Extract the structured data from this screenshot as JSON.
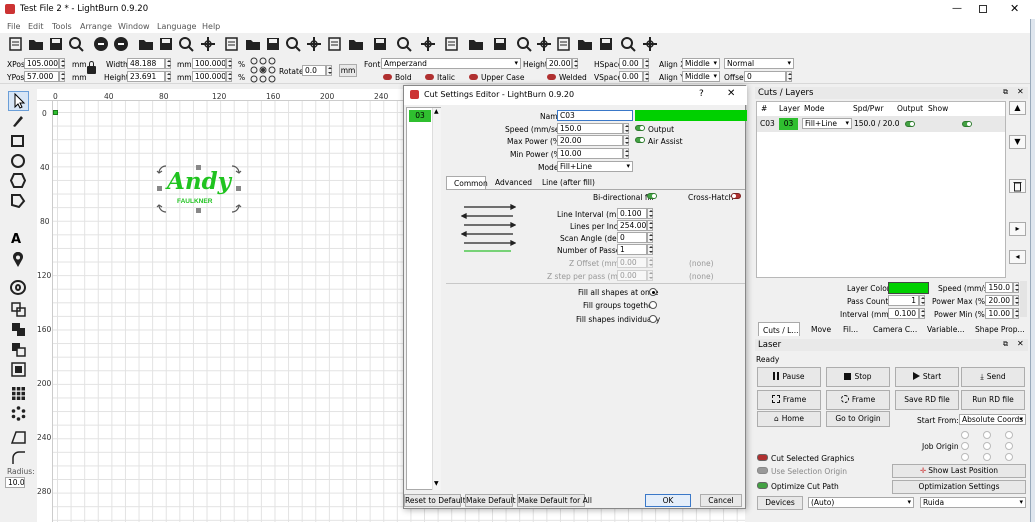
{
  "window": {
    "title": "Test File 2 * - LightBurn 0.9.20"
  },
  "menu": [
    "File",
    "Edit",
    "Tools",
    "Arrange",
    "Window",
    "Language",
    "Help"
  ],
  "props": {
    "xpos_label": "XPos",
    "xpos": "105.000",
    "ypos_label": "YPos",
    "ypos": "57.000",
    "unit": "mm",
    "width_label": "Width",
    "width": "48.188",
    "height_label": "Height",
    "height": "23.691",
    "wpct": "100.000",
    "hpct": "100.000",
    "pct": "%",
    "rotate_label": "Rotate",
    "rotate": "0.0",
    "mm_btn": "mm",
    "font_label": "Font",
    "font": "Amperzand",
    "fheight_label": "Height",
    "fheight": "20.00",
    "hspace_label": "HSpace",
    "hspace": "0.00",
    "vspace_label": "VSpace",
    "vspace": "0.00",
    "alignx_label": "Align X",
    "alignx": "Middle",
    "aligny_label": "Align Y",
    "aligny": "Middle",
    "style": "Normal",
    "offset_label": "Offset",
    "offset": "0",
    "bold": "Bold",
    "italic": "Italic",
    "upper": "Upper Case",
    "welded": "Welded"
  },
  "rulers": {
    "top": [
      "0",
      "40",
      "80",
      "120",
      "160",
      "200",
      "240"
    ],
    "left": [
      "0",
      "40",
      "80",
      "120",
      "160",
      "200",
      "240",
      "280"
    ]
  },
  "canvas_text": {
    "name": "Andy",
    "sub": "FAULKNER"
  },
  "left_toolbar": {
    "radius_label": "Radius:",
    "radius": "10.0"
  },
  "dialog": {
    "title": "Cut Settings Editor - LightBurn 0.9.20",
    "help": "?",
    "close": "✕",
    "layer_num": "03",
    "name_label": "Name",
    "name": "C03",
    "speed_label": "Speed (mm/sec)",
    "speed": "150.0",
    "maxp_label": "Max Power (%)",
    "maxp": "20.00",
    "minp_label": "Min Power (%)",
    "minp": "10.00",
    "mode_label": "Mode",
    "mode": "Fill+Line",
    "output": "Output",
    "air": "Air Assist",
    "tabs": [
      "Common",
      "Advanced",
      "Line (after fill)"
    ],
    "bidir": "Bi-directional fill",
    "cross": "Cross-Hatch",
    "interval_label": "Line Interval (mm)",
    "interval": "0.100",
    "lpi_label": "Lines per Inch",
    "lpi": "254.00",
    "angle_label": "Scan Angle (deg)",
    "angle": "0",
    "passes_label": "Number of Passes",
    "passes": "1",
    "zoff_label": "Z Offset (mm)",
    "zoff": "0.00",
    "zoff_none": "(none)",
    "zstep_label": "Z step per pass (mm)",
    "zstep": "0.00",
    "zstep_none": "(none)",
    "fill_all": "Fill all shapes at once",
    "fill_groups": "Fill groups together",
    "fill_ind": "Fill shapes individually",
    "reset": "Reset to Default",
    "make_default": "Make Default",
    "make_all": "Make Default for All",
    "ok": "OK",
    "cancel": "Cancel"
  },
  "cuts": {
    "title": "Cuts / Layers",
    "headers": [
      "#",
      "Layer",
      "Mode",
      "Spd/Pwr",
      "Output",
      "Show"
    ],
    "row": {
      "num": "C03",
      "layer": "03",
      "mode": "Fill+Line",
      "spdpwr": "150.0 / 20.0"
    },
    "layer_color": "Layer Color",
    "speed_label": "Speed (mm/s)",
    "speed": "150.0",
    "pass_label": "Pass Count",
    "pass": "1",
    "pmax_label": "Power Max (%)",
    "pmax": "20.00",
    "int_label": "Interval (mm)",
    "int": "0.100",
    "pmin_label": "Power Min (%)",
    "pmin": "10.00",
    "tabs": [
      "Cuts / L...",
      "Move",
      "Fil...",
      "Camera C...",
      "Variable...",
      "Shape Prop..."
    ]
  },
  "laser": {
    "title": "Laser",
    "status": "Ready",
    "pause": "Pause",
    "stop": "Stop",
    "start": "Start",
    "send": "Send",
    "frame1": "Frame",
    "frame2": "Frame",
    "save_rd": "Save RD file",
    "run_rd": "Run RD file",
    "home": "Home",
    "go_origin": "Go to Origin",
    "start_from": "Start From:",
    "start_from_val": "Absolute Coords",
    "job_origin": "Job Origin",
    "cut_sel": "Cut Selected Graphics",
    "use_sel": "Use Selection Origin",
    "opt_cut": "Optimize Cut Path",
    "show_last": "Show Last Position",
    "opt_settings": "Optimization Settings",
    "devices": "Devices",
    "auto": "(Auto)",
    "ruida": "Ruida"
  },
  "colors": {
    "accent_green": "#00d000",
    "layer_green": "#2fbf2f",
    "text_green": "#1fc31f"
  }
}
